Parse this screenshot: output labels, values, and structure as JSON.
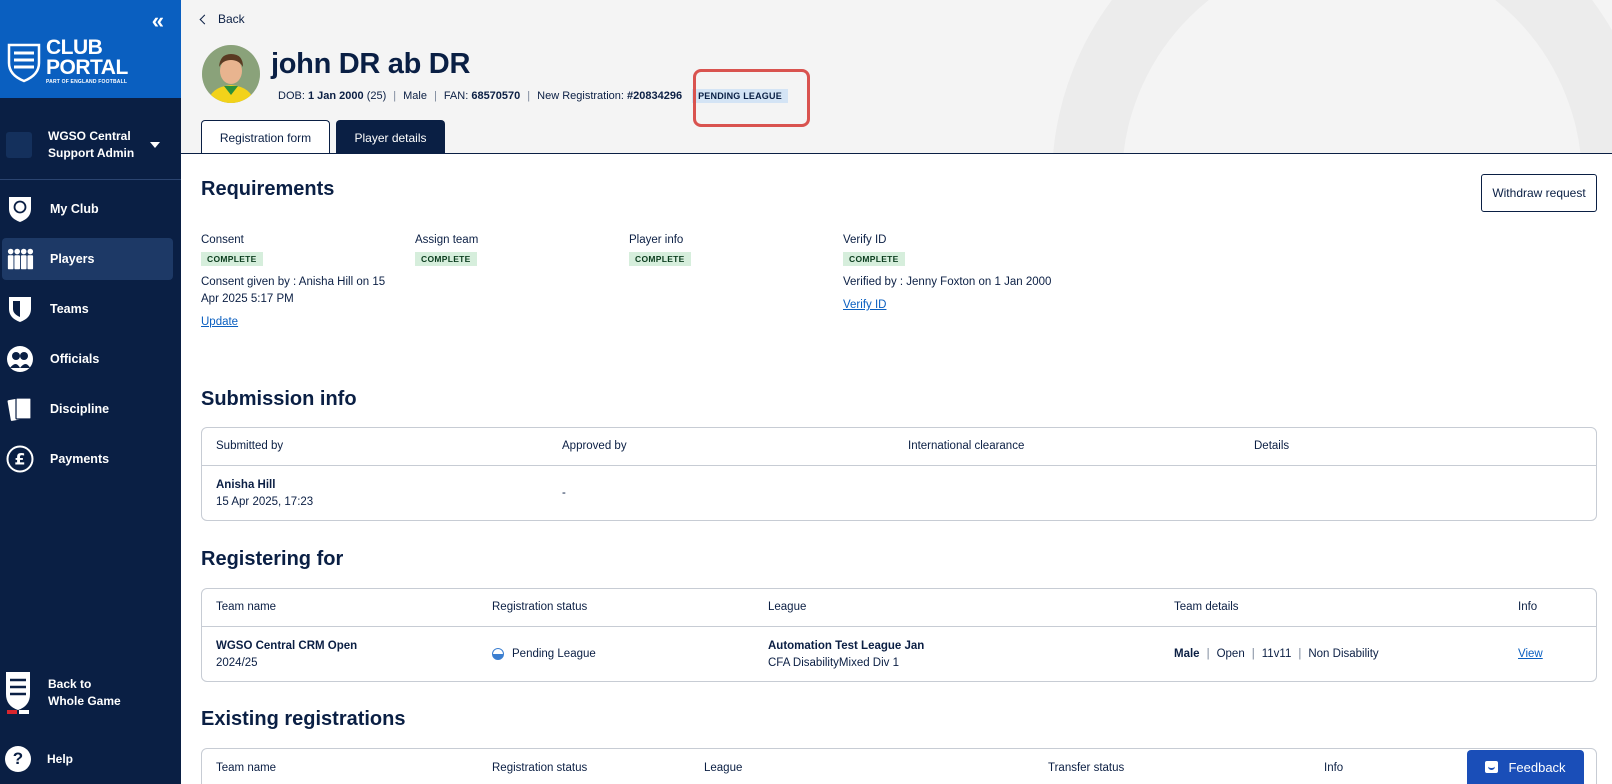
{
  "sidebar": {
    "logo_main": "CLUB",
    "logo_main2": "PORTAL",
    "logo_sub": "PART OF ENGLAND FOOTBALL",
    "collapse_glyph": "«",
    "club_name": "WGSO Central Support Admin",
    "nav": [
      {
        "label": "My Club",
        "icon": "ball-shield-icon",
        "active": false
      },
      {
        "label": "Players",
        "icon": "players-icon",
        "active": true
      },
      {
        "label": "Teams",
        "icon": "shield-icon",
        "active": false
      },
      {
        "label": "Officials",
        "icon": "officials-icon",
        "active": false
      },
      {
        "label": "Discipline",
        "icon": "cards-icon",
        "active": false
      },
      {
        "label": "Payments",
        "icon": "pound-icon",
        "active": false
      }
    ],
    "back_to_whole_game": "Back to Whole Game",
    "help": "Help"
  },
  "header": {
    "back": "Back",
    "player_name": "john DR ab DR",
    "dob_label": "DOB:",
    "dob_value": "1 Jan 2000",
    "age": "(25)",
    "gender": "Male",
    "fan_label": "FAN:",
    "fan_value": "68570570",
    "reg_label": "New Registration:",
    "reg_value": "#20834296",
    "status_badge": "PENDING LEAGUE",
    "tabs": [
      "Registration form",
      "Player details"
    ]
  },
  "requirements": {
    "title": "Requirements",
    "withdraw": "Withdraw request",
    "items": [
      {
        "title": "Consent",
        "status": "COMPLETE",
        "note": "Consent given by : Anisha Hill on 15 Apr 2025 5:17 PM",
        "link": "Update"
      },
      {
        "title": "Assign team",
        "status": "COMPLETE"
      },
      {
        "title": "Player info",
        "status": "COMPLETE"
      },
      {
        "title": "Verify ID",
        "status": "COMPLETE",
        "note": "Verified by : Jenny Foxton on 1 Jan 2000",
        "link": "Verify ID"
      }
    ]
  },
  "submission": {
    "title": "Submission info",
    "headers": [
      "Submitted by",
      "Approved by",
      "International clearance",
      "Details"
    ],
    "row": {
      "submitted_name": "Anisha Hill",
      "submitted_date": "15 Apr 2025, 17:23",
      "approved_by": "-"
    }
  },
  "registering": {
    "title": "Registering for",
    "headers": [
      "Team name",
      "Registration status",
      "League",
      "Team details",
      "Info"
    ],
    "row": {
      "team_name": "WGSO Central CRM Open",
      "season": "2024/25",
      "status": "Pending League",
      "league": "Automation Test League Jan",
      "division": "CFA DisabilityMixed Div 1",
      "gender": "Male",
      "type": "Open",
      "format": "11v11",
      "disability": "Non Disability",
      "info_link": "View"
    }
  },
  "existing": {
    "title": "Existing registrations",
    "headers": [
      "Team name",
      "Registration status",
      "League",
      "Transfer status",
      "Info"
    ]
  },
  "feedback": "Feedback",
  "colors": {
    "sidebar": "#0a1f44",
    "brand": "#0a5fc0",
    "highlight": "#d9534f",
    "complete_bg": "#d6eedc",
    "pending_bg": "#d4e4f5"
  }
}
